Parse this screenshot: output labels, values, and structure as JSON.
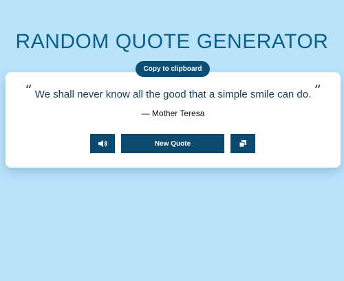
{
  "app": {
    "title": "RANDOM QUOTE GENERATOR"
  },
  "tooltip": {
    "copy_label": "Copy to clipboard"
  },
  "quote": {
    "open_mark": "“",
    "text": "We shall never know all the good that a simple smile can do.",
    "close_mark": "”",
    "author": "— Mother Teresa"
  },
  "controls": {
    "speak_icon": "speaker-icon",
    "new_quote_label": "New Quote",
    "copy_icon": "copy-icon"
  },
  "colors": {
    "background": "#b9e3fb",
    "title": "#0b5f8a",
    "button": "#0b4a6e",
    "card": "#ffffff"
  }
}
